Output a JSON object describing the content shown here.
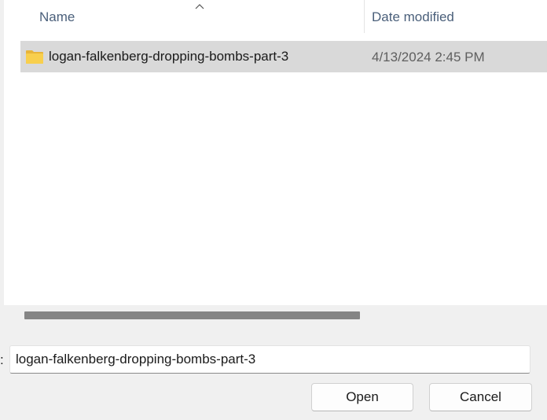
{
  "file_list": {
    "columns": {
      "name": "Name",
      "date_modified": "Date modified"
    },
    "sort_icon": "chevron-up-icon",
    "items": [
      {
        "icon": "folder-icon",
        "name": "logan-falkenberg-dropping-bombs-part-3",
        "date_modified": "4/13/2024 2:45 PM",
        "selected": true
      }
    ]
  },
  "footer": {
    "filename_label": ":",
    "filename_value": "logan-falkenberg-dropping-bombs-part-3",
    "open_label": "Open",
    "cancel_label": "Cancel"
  },
  "colors": {
    "selected_row": "#d9d9d9",
    "header_text": "#4a5f7a",
    "folder_yellow": "#f8cf4d",
    "scroll_thumb": "#858585"
  }
}
